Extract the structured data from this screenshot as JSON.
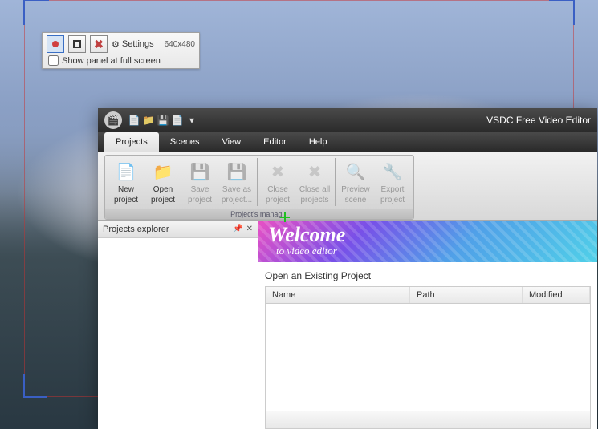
{
  "capture_panel": {
    "settings_label": "Settings",
    "dimensions": "640x480",
    "full_screen_label": "Show panel at full screen",
    "full_screen_checked": false,
    "icons": {
      "record": "record-icon",
      "region": "region-icon",
      "cancel": "cancel-icon",
      "gear": "gear-icon"
    }
  },
  "app": {
    "title": "VSDC Free Video Editor",
    "quick_access": [
      {
        "name": "new-doc",
        "glyph": "📄",
        "color": "#6c6"
      },
      {
        "name": "open-folder",
        "glyph": "📁",
        "color": "#fc6"
      },
      {
        "name": "save",
        "glyph": "💾",
        "color": "#ccc"
      },
      {
        "name": "page",
        "glyph": "📄",
        "color": "#ccc"
      }
    ]
  },
  "menu": {
    "tabs": [
      {
        "label": "Projects",
        "active": true
      },
      {
        "label": "Scenes",
        "active": false
      },
      {
        "label": "View",
        "active": false
      },
      {
        "label": "Editor",
        "active": false
      },
      {
        "label": "Help",
        "active": false
      }
    ]
  },
  "ribbon": {
    "group_label": "Project's manag...",
    "buttons": [
      {
        "line1": "New",
        "line2": "project",
        "enabled": true,
        "icon": "new-project-icon",
        "glyph": "📄"
      },
      {
        "line1": "Open",
        "line2": "project",
        "enabled": true,
        "icon": "open-project-icon",
        "glyph": "📁"
      },
      {
        "line1": "Save",
        "line2": "project",
        "enabled": false,
        "icon": "save-project-icon",
        "glyph": "💾"
      },
      {
        "line1": "Save as",
        "line2": "project...",
        "enabled": false,
        "icon": "save-as-icon",
        "glyph": "💾"
      },
      {
        "line1": "Close",
        "line2": "project",
        "enabled": false,
        "icon": "close-project-icon",
        "glyph": "✖"
      },
      {
        "line1": "Close all",
        "line2": "projects",
        "enabled": false,
        "icon": "close-all-icon",
        "glyph": "✖"
      },
      {
        "line1": "Preview",
        "line2": "scene",
        "enabled": false,
        "icon": "preview-icon",
        "glyph": "🔍"
      },
      {
        "line1": "Export",
        "line2": "project",
        "enabled": false,
        "icon": "export-icon",
        "glyph": "🔧"
      }
    ]
  },
  "explorer": {
    "title": "Projects explorer"
  },
  "welcome": {
    "big": "Welcome",
    "small": "to video editor"
  },
  "open_existing": {
    "label": "Open an Existing Project",
    "columns": [
      "Name",
      "Path",
      "Modified"
    ],
    "rows": []
  }
}
